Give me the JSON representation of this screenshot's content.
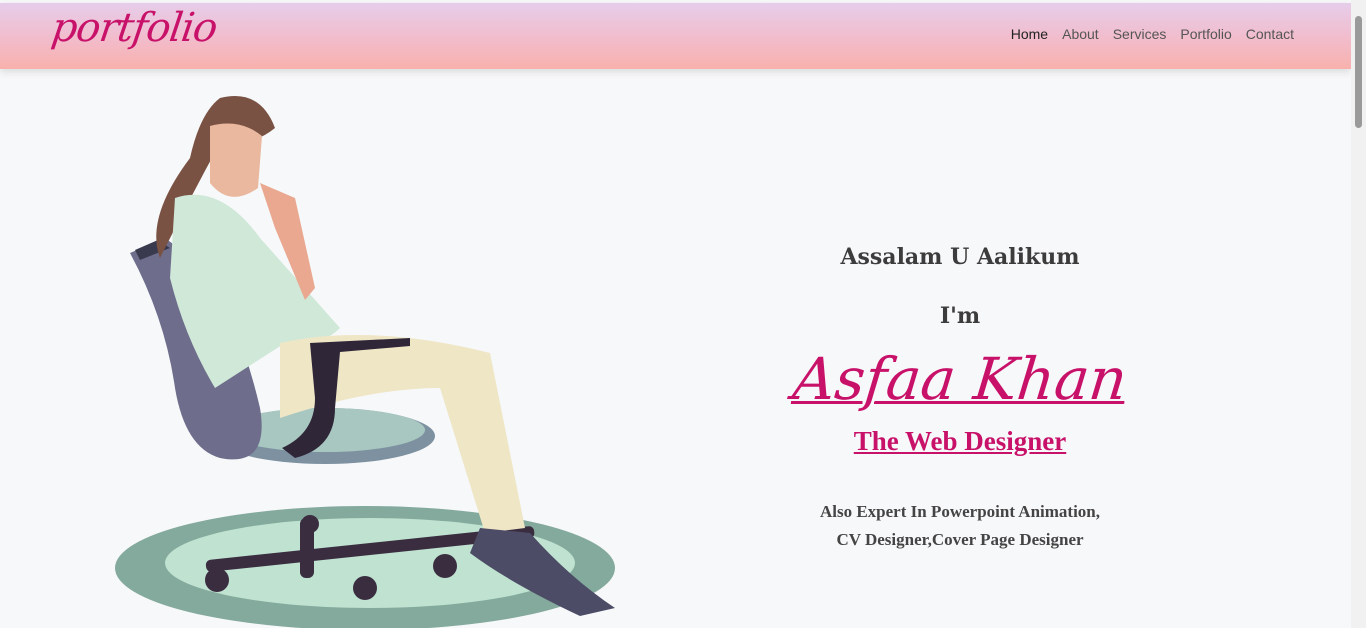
{
  "navbar": {
    "logo": "portfolio",
    "links": [
      {
        "label": "Home"
      },
      {
        "label": "About"
      },
      {
        "label": "Services"
      },
      {
        "label": "Portfolio"
      },
      {
        "label": "Contact"
      }
    ]
  },
  "hero": {
    "greeting": "Assalam U Aalikum",
    "intro": "I'm",
    "name": "Asfaa Khan",
    "role": "The Web Designer",
    "expertise_line1": "Also Expert In Powerpoint Animation,",
    "expertise_line2": "CV Designer,Cover Page Designer"
  },
  "colors": {
    "accent": "#c8126a",
    "nav_gradient_top": "#e6cdea",
    "nav_gradient_bottom": "#f8b1ad",
    "background": "#f7f8fa"
  },
  "icons": {
    "illustration": "woman-sitting-in-office-chair-illustration"
  }
}
